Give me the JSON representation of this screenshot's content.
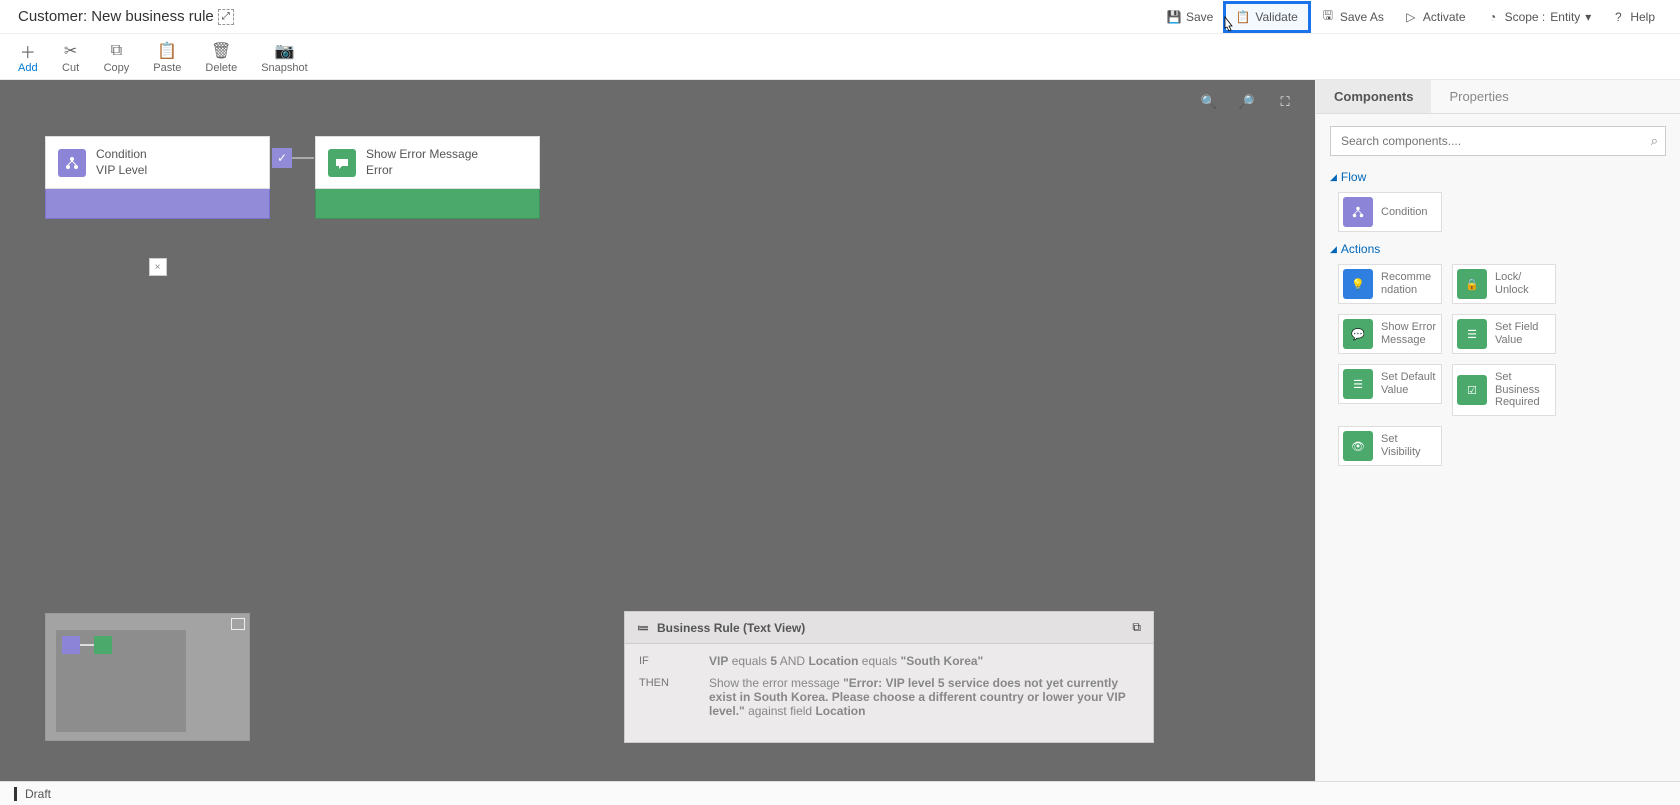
{
  "header": {
    "title_prefix": "Customer:",
    "title": "New business rule",
    "buttons": {
      "save": "Save",
      "validate": "Validate",
      "save_as": "Save As",
      "activate": "Activate",
      "help": "Help"
    },
    "scope_label": "Scope :",
    "scope_value": "Entity"
  },
  "toolbar": {
    "add": "Add",
    "cut": "Cut",
    "copy": "Copy",
    "paste": "Paste",
    "delete": "Delete",
    "snapshot": "Snapshot"
  },
  "canvas": {
    "condition": {
      "title": "Condition",
      "subtitle": "VIP Level"
    },
    "error": {
      "title": "Show Error Message",
      "subtitle": "Error"
    }
  },
  "text_view": {
    "title": "Business Rule (Text View)",
    "if": "IF",
    "then": "THEN",
    "cond_field1": "VIP",
    "cond_op1": "equals",
    "cond_val1": "5",
    "cond_and": "AND",
    "cond_field2": "Location",
    "cond_op2": "equals",
    "cond_val2": "\"South Korea\"",
    "then_pre": "Show the error message",
    "then_msg": "\"Error: VIP level 5 service does not yet currently exist in South Korea. Please choose a different country or lower your VIP level.\"",
    "then_post": "against field",
    "then_field": "Location"
  },
  "side": {
    "tabs": {
      "components": "Components",
      "properties": "Properties"
    },
    "search_placeholder": "Search components....",
    "sec_flow": "Flow",
    "sec_actions": "Actions",
    "comp_condition": "Condition",
    "comp_recommendation": "Recomme\nndation",
    "comp_lock": "Lock/\nUnlock",
    "comp_error": "Show Error Message",
    "comp_setfield": "Set Field Value",
    "comp_setdefault": "Set Default Value",
    "comp_bizreq": "Set Business Required",
    "comp_visibility": "Set Visibility"
  },
  "footer": {
    "status": "Draft"
  }
}
